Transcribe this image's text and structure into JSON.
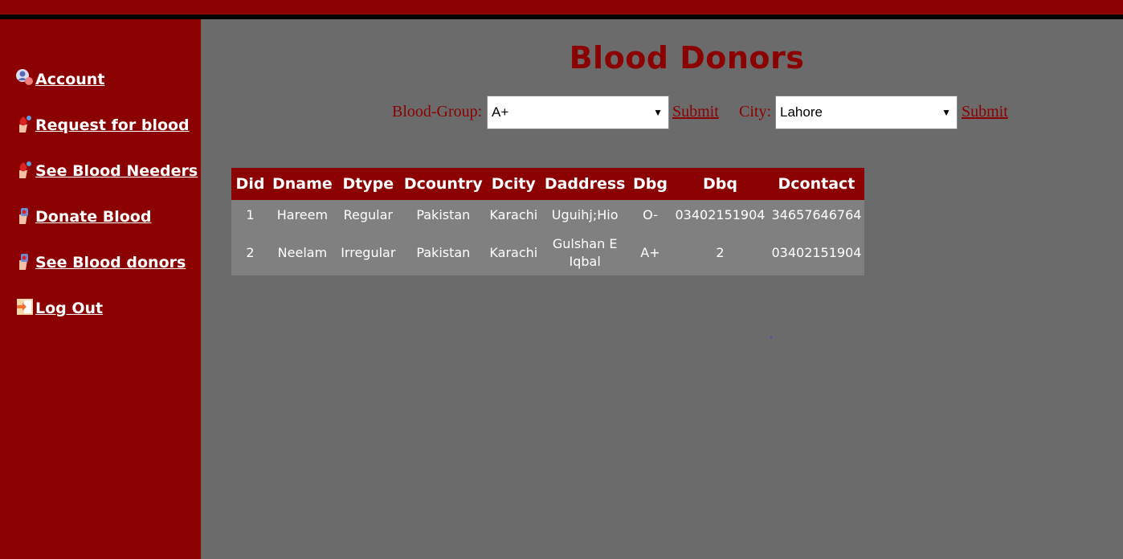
{
  "sidebar": {
    "items": [
      {
        "label": "Account",
        "icon": "user-icon"
      },
      {
        "label": "Request for blood",
        "icon": "blood-hand-icon"
      },
      {
        "label": "See Blood Needers",
        "icon": "blood-hand-icon"
      },
      {
        "label": "Donate Blood",
        "icon": "donate-hand-icon"
      },
      {
        "label": "See Blood donors",
        "icon": "donate-hand-icon"
      },
      {
        "label": "Log Out",
        "icon": "logout-icon"
      }
    ]
  },
  "main": {
    "title": "Blood Donors",
    "filters": {
      "blood_group_label": "Blood-Group:",
      "blood_group_value": "A+",
      "blood_group_submit": "Submit",
      "city_label": "City:",
      "city_value": "Lahore",
      "city_submit": "Submit"
    },
    "table": {
      "headers": [
        "Did",
        "Dname",
        "Dtype",
        "Dcountry",
        "Dcity",
        "Daddress",
        "Dbg",
        "Dbq",
        "Dcontact"
      ],
      "rows": [
        [
          "1",
          "Hareem",
          "Regular",
          "Pakistan",
          "Karachi",
          "Uguihj;Hio",
          "O-",
          "03402151904",
          "34657646764"
        ],
        [
          "2",
          "Neelam",
          "Irregular",
          "Pakistan",
          "Karachi",
          "Gulshan E Iqbal",
          "A+",
          "2",
          "03402151904"
        ]
      ]
    }
  },
  "colors": {
    "brand": "#8b0000",
    "content_bg": "#6b6b6b",
    "table_body": "#808080"
  }
}
